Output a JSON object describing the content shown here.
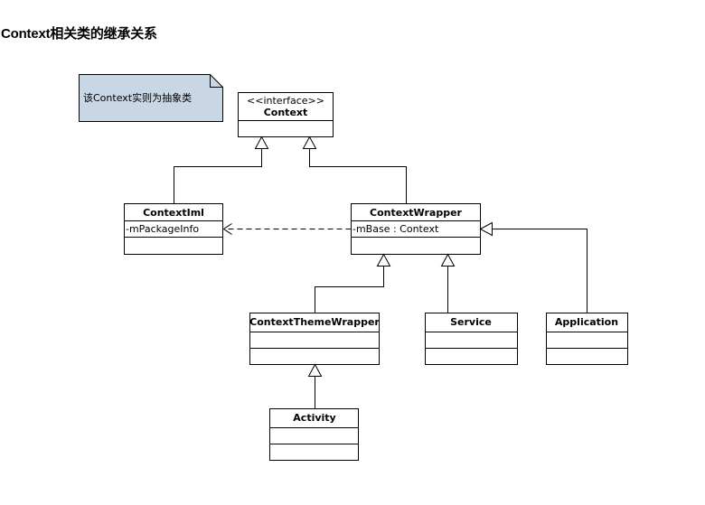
{
  "page": {
    "title": "Context相关类的继承关系"
  },
  "note": {
    "text": "该Context实则为抽象类",
    "fill": "#c8d6e5"
  },
  "classes": {
    "context": {
      "stereotype": "<<interface>>",
      "name": "Context"
    },
    "contextiml": {
      "name": "ContextIml",
      "attribute": "-mPackageInfo"
    },
    "contextwrapper": {
      "name": "ContextWrapper",
      "attribute": "-mBase : Context"
    },
    "contextthemewrapper": {
      "name": "ContextThemeWrapper"
    },
    "service": {
      "name": "Service"
    },
    "application": {
      "name": "Application"
    },
    "activity": {
      "name": "Activity"
    }
  },
  "relationships": [
    {
      "from": "ContextIml",
      "to": "Context",
      "type": "generalization"
    },
    {
      "from": "ContextWrapper",
      "to": "Context",
      "type": "generalization"
    },
    {
      "from": "ContextWrapper",
      "to": "ContextIml",
      "type": "dependency"
    },
    {
      "from": "ContextThemeWrapper",
      "to": "ContextWrapper",
      "type": "generalization"
    },
    {
      "from": "Service",
      "to": "ContextWrapper",
      "type": "generalization"
    },
    {
      "from": "Application",
      "to": "ContextWrapper",
      "type": "generalization"
    },
    {
      "from": "Activity",
      "to": "ContextThemeWrapper",
      "type": "generalization"
    }
  ]
}
